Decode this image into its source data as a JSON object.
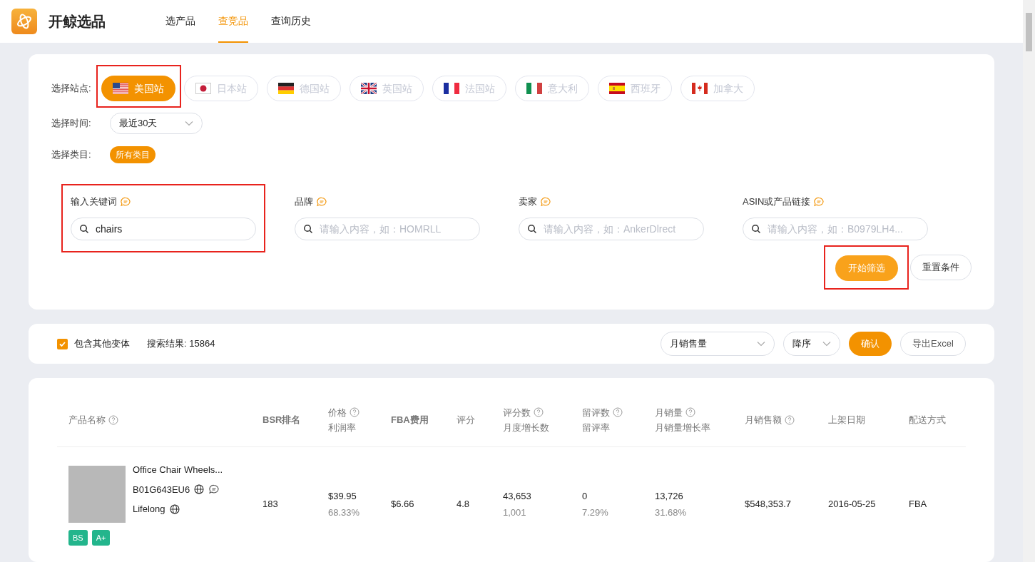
{
  "app": {
    "name": "开鲸选品"
  },
  "nav": [
    {
      "label": "选产品",
      "selected": false
    },
    {
      "label": "查竞品",
      "selected": true
    },
    {
      "label": "查询历史",
      "selected": false
    }
  ],
  "filters": {
    "station_label": "选择站点:",
    "stations": [
      {
        "label": "美国站",
        "kind": "us",
        "selected": true,
        "highlighted": true
      },
      {
        "label": "日本站",
        "kind": "jp",
        "selected": false,
        "highlighted": false
      },
      {
        "label": "德国站",
        "kind": "de",
        "selected": false,
        "highlighted": false
      },
      {
        "label": "英国站",
        "kind": "uk",
        "selected": false,
        "highlighted": false
      },
      {
        "label": "法国站",
        "kind": "fr",
        "selected": false,
        "highlighted": false
      },
      {
        "label": "意大利",
        "kind": "it",
        "selected": false,
        "highlighted": false
      },
      {
        "label": "西班牙",
        "kind": "es",
        "selected": false,
        "highlighted": false
      },
      {
        "label": "加拿大",
        "kind": "ca",
        "selected": false,
        "highlighted": false
      }
    ],
    "time_label": "选择时间:",
    "time_value": "最近30天",
    "category_label": "选择类目:",
    "category_value": "所有类目",
    "fields": [
      {
        "label": "输入关键词",
        "value": "chairs",
        "highlighted": true
      },
      {
        "label": "品牌",
        "placeholder": "请输入内容，如：HOMRLL",
        "highlighted": false
      },
      {
        "label": "卖家",
        "placeholder": "请输入内容，如：AnkerDlrect",
        "highlighted": false
      },
      {
        "label": "ASIN或产品链接",
        "placeholder": "请输入内容，如：B0979LH4...",
        "highlighted": false
      }
    ],
    "start_button": {
      "label": "开始筛选",
      "highlighted": true
    },
    "reset_button": "重置条件"
  },
  "toolbar": {
    "include_variants": {
      "label": "包含其他变体",
      "checked": true
    },
    "result_text": "搜索结果: 15864",
    "sort_field": "月销售量",
    "sort_order": "降序",
    "confirm": "确认",
    "export": "导出Excel"
  },
  "table": {
    "columns": [
      {
        "lines": [
          "产品名称"
        ],
        "help": true
      },
      {
        "lines": [
          "BSR排名"
        ],
        "help": false
      },
      {
        "lines": [
          "价格",
          "利润率"
        ],
        "help": true
      },
      {
        "lines": [
          "FBA费用"
        ],
        "help": false
      },
      {
        "lines": [
          "评分"
        ],
        "help": false
      },
      {
        "lines": [
          "评分数",
          "月度增长数"
        ],
        "help": true
      },
      {
        "lines": [
          "留评数",
          "留评率"
        ],
        "help": true
      },
      {
        "lines": [
          "月销量",
          "月销量增长率"
        ],
        "help": true
      },
      {
        "lines": [
          "月销售额"
        ],
        "help": true
      },
      {
        "lines": [
          "上架日期"
        ],
        "help": false
      },
      {
        "lines": [
          "配送方式"
        ],
        "help": false
      }
    ],
    "rows": [
      {
        "cells": [
          {
            "kind": "product",
            "title": "Office Chair Wheels...",
            "asin": "B01G643EU6",
            "brand": "Lifelong",
            "badges": [
              "BS",
              "A+"
            ]
          },
          {
            "kind": "value",
            "main": "183"
          },
          {
            "kind": "value",
            "main": "$39.95",
            "sub": "68.33%"
          },
          {
            "kind": "value",
            "main": "$6.66"
          },
          {
            "kind": "value",
            "main": "4.8"
          },
          {
            "kind": "value",
            "main": "43,653",
            "sub": "1,001"
          },
          {
            "kind": "value",
            "main": "0",
            "sub": "7.29%"
          },
          {
            "kind": "value",
            "main": "13,726",
            "sub": "31.68%"
          },
          {
            "kind": "value",
            "main": "$548,353.7"
          },
          {
            "kind": "value",
            "main": "2016-05-25"
          },
          {
            "kind": "value",
            "main": "FBA"
          }
        ]
      }
    ]
  }
}
